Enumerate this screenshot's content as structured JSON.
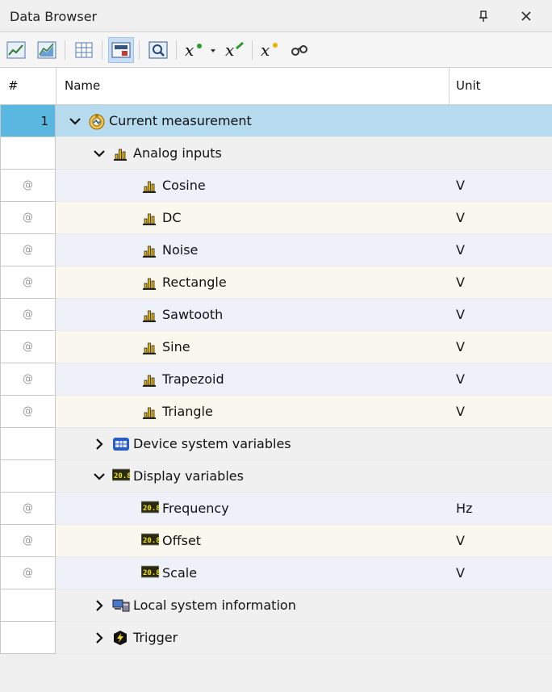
{
  "panel": {
    "title": "Data Browser"
  },
  "toolbar": {
    "buttons": [
      "chart-line-icon",
      "chart-area-icon",
      "table-icon",
      "display-panel-icon",
      "zoom-chart-icon",
      "formula-dropdown-icon",
      "formula-edit-icon",
      "formula-new-icon",
      "binoculars-icon"
    ]
  },
  "columns": {
    "num": "#",
    "name": "Name",
    "unit": "Unit"
  },
  "rows": [
    {
      "num": "1",
      "label": "Current measurement",
      "unit": "",
      "level": 0,
      "expand": "open",
      "icon": "measurement-icon"
    },
    {
      "num": "",
      "label": "Analog inputs",
      "unit": "",
      "level": 1,
      "expand": "open",
      "icon": "analog-icon"
    },
    {
      "num": "@",
      "label": "Cosine",
      "unit": "V",
      "level": 2,
      "icon": "analog-icon"
    },
    {
      "num": "@",
      "label": "DC",
      "unit": "V",
      "level": 2,
      "icon": "analog-icon"
    },
    {
      "num": "@",
      "label": "Noise",
      "unit": "V",
      "level": 2,
      "icon": "analog-icon"
    },
    {
      "num": "@",
      "label": "Rectangle",
      "unit": "V",
      "level": 2,
      "icon": "analog-icon"
    },
    {
      "num": "@",
      "label": "Sawtooth",
      "unit": "V",
      "level": 2,
      "icon": "analog-icon"
    },
    {
      "num": "@",
      "label": "Sine",
      "unit": "V",
      "level": 2,
      "icon": "analog-icon"
    },
    {
      "num": "@",
      "label": "Trapezoid",
      "unit": "V",
      "level": 2,
      "icon": "analog-icon"
    },
    {
      "num": "@",
      "label": "Triangle",
      "unit": "V",
      "level": 2,
      "icon": "analog-icon"
    },
    {
      "num": "",
      "label": "Device system variables",
      "unit": "",
      "level": 1,
      "expand": "closed",
      "icon": "device-icon"
    },
    {
      "num": "",
      "label": "Display variables",
      "unit": "",
      "level": 1,
      "expand": "open",
      "icon": "display-var-icon"
    },
    {
      "num": "@",
      "label": "Frequency",
      "unit": "Hz",
      "level": 2,
      "icon": "display-var-icon"
    },
    {
      "num": "@",
      "label": "Offset",
      "unit": "V",
      "level": 2,
      "icon": "display-var-icon"
    },
    {
      "num": "@",
      "label": "Scale",
      "unit": "V",
      "level": 2,
      "icon": "display-var-icon"
    },
    {
      "num": "",
      "label": "Local system information",
      "unit": "",
      "level": 1,
      "expand": "closed",
      "icon": "computer-icon"
    },
    {
      "num": "",
      "label": "Trigger",
      "unit": "",
      "level": 1,
      "expand": "closed",
      "icon": "trigger-icon"
    }
  ]
}
